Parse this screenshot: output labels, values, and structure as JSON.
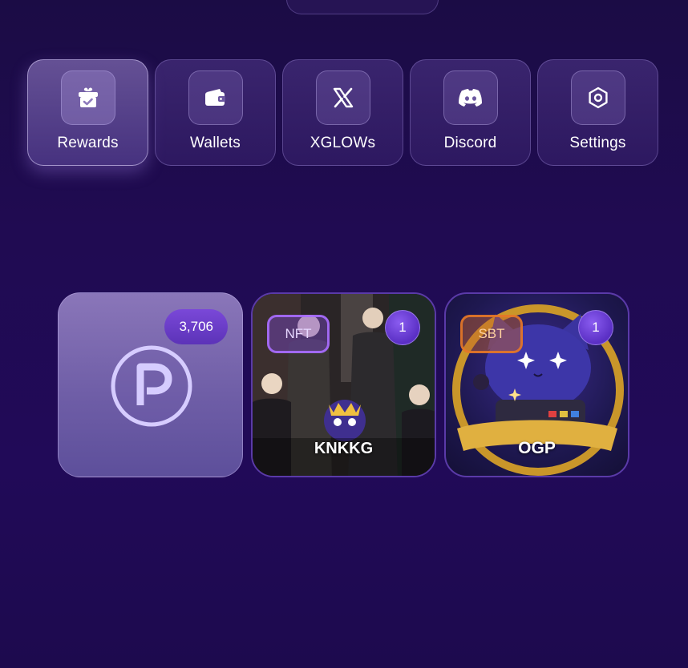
{
  "menu": [
    {
      "label": "Rewards",
      "icon": "gift-icon",
      "active": true
    },
    {
      "label": "Wallets",
      "icon": "wallet-icon",
      "active": false
    },
    {
      "label": "XGLOWs",
      "icon": "x-logo-icon",
      "active": false
    },
    {
      "label": "Discord",
      "icon": "discord-icon",
      "active": false
    },
    {
      "label": "Settings",
      "icon": "gear-icon",
      "active": false
    }
  ],
  "tiles": {
    "points": {
      "count": "3,706",
      "icon": "points-p-icon"
    },
    "nft": {
      "tag": "NFT",
      "count": "1",
      "title": "KNKKG"
    },
    "sbt": {
      "tag": "SBT",
      "count": "1",
      "title": "OGP"
    }
  },
  "colors": {
    "background": "#200b52",
    "badge": "#6a3cd0",
    "nft_tag": "#9a5cff",
    "sbt_tag": "#e07828"
  }
}
